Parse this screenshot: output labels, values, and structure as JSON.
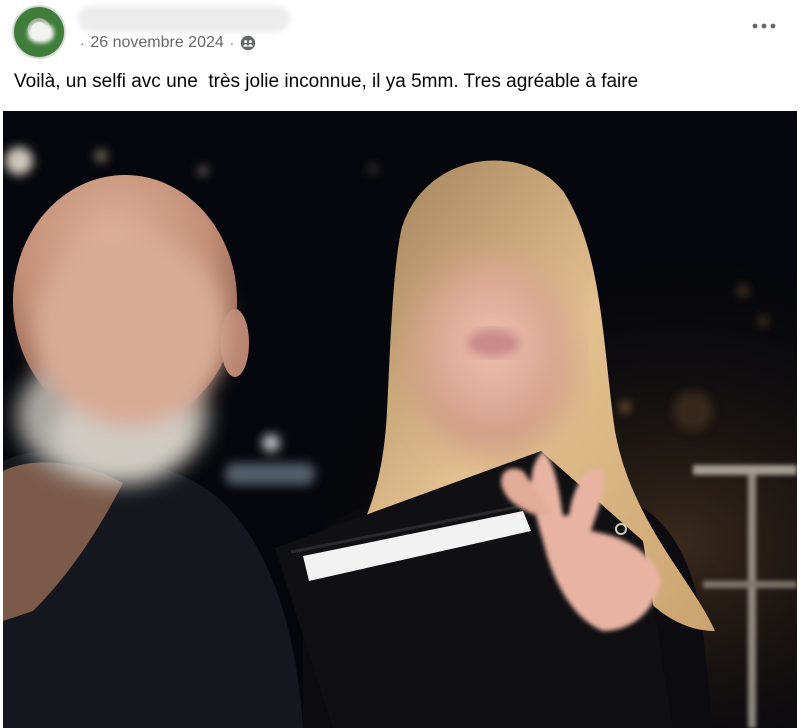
{
  "post": {
    "author_name": "",
    "date": "26 novembre 2024",
    "separator": "·",
    "audience_icon": "friends-icon",
    "more_icon": "more-horizontal-icon",
    "caption": "Voilà, un selfi avc une  très jolie inconnue, il ya 5mm. Tres agréable à faire"
  },
  "photo": {
    "subject": "selfie"
  },
  "colors": {
    "meta_text": "#65676b",
    "text": "#050505",
    "photo_background": "#06070c"
  }
}
